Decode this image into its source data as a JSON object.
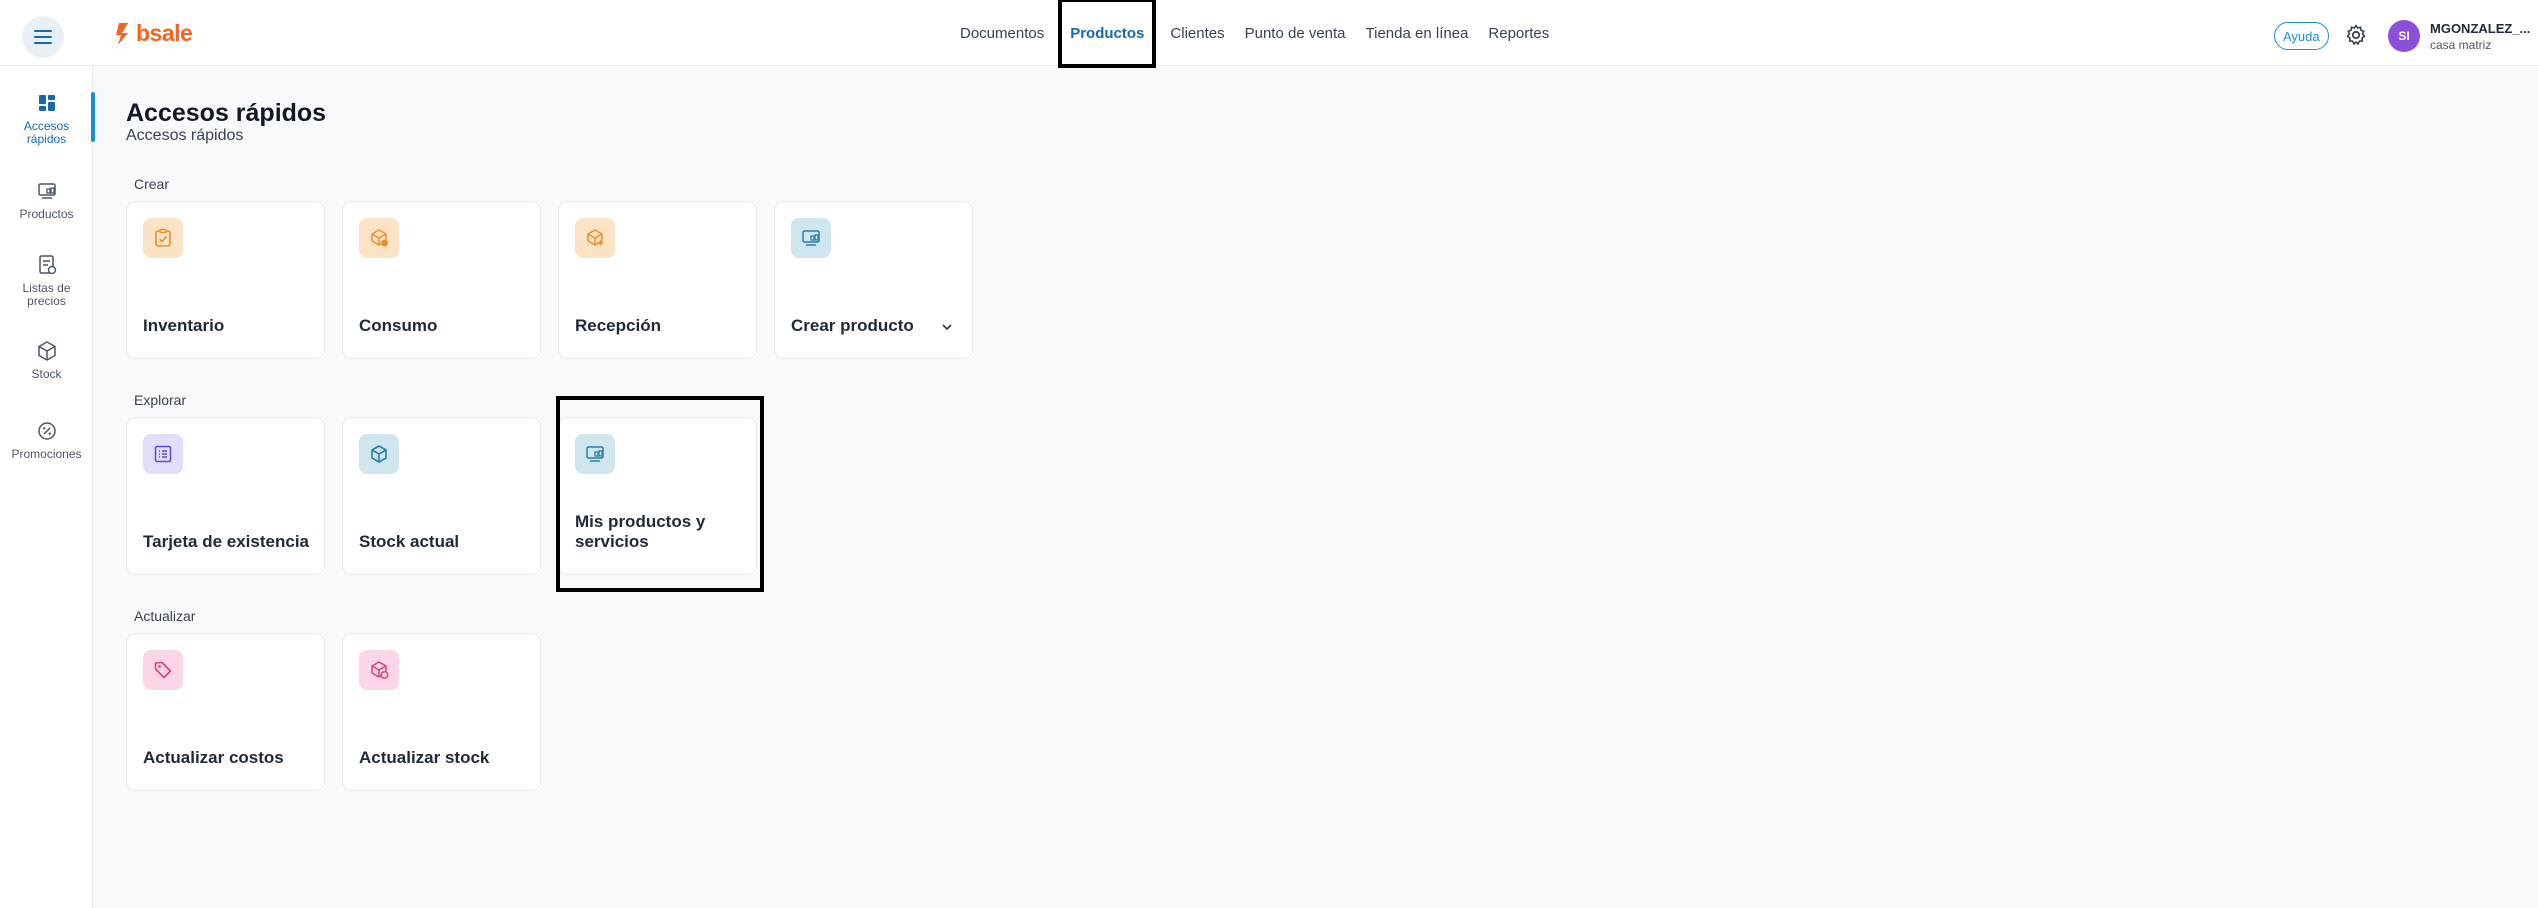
{
  "header": {
    "logo_text": "bsale",
    "nav": [
      {
        "label": "Documentos",
        "active": false
      },
      {
        "label": "Productos",
        "active": true
      },
      {
        "label": "Clientes",
        "active": false
      },
      {
        "label": "Punto de venta",
        "active": false
      },
      {
        "label": "Tienda en línea",
        "active": false
      },
      {
        "label": "Reportes",
        "active": false
      }
    ],
    "help_label": "Ayuda",
    "avatar_initials": "SI",
    "user_name": "MGONZALEZ_...",
    "user_sub": "casa matriz"
  },
  "sidebar": {
    "items": [
      {
        "label": "Accesos rápidos",
        "icon": "dashboard-icon",
        "active": true
      },
      {
        "label": "Productos",
        "icon": "products-icon",
        "active": false
      },
      {
        "label": "Listas de precios",
        "icon": "price-list-icon",
        "active": false
      },
      {
        "label": "Stock",
        "icon": "box-icon",
        "active": false
      },
      {
        "label": "Promociones",
        "icon": "promotion-icon",
        "active": false
      }
    ]
  },
  "main": {
    "title": "Accesos rápidos",
    "subtitle": "Accesos rápidos",
    "sections": [
      {
        "label": "Crear",
        "cards": [
          {
            "label": "Inventario",
            "icon": "clipboard-check-icon",
            "color": "orange"
          },
          {
            "label": "Consumo",
            "icon": "box-alert-icon",
            "color": "orange"
          },
          {
            "label": "Recepción",
            "icon": "box-add-icon",
            "color": "orange"
          },
          {
            "label": "Crear producto",
            "icon": "products-icon",
            "color": "teal",
            "has_dropdown": true
          }
        ]
      },
      {
        "label": "Explorar",
        "cards": [
          {
            "label": "Tarjeta de existencia",
            "icon": "list-card-icon",
            "color": "violet"
          },
          {
            "label": "Stock actual",
            "icon": "box-icon",
            "color": "teal"
          },
          {
            "label": "Mis productos y servicios",
            "icon": "products-icon",
            "color": "teal"
          }
        ]
      },
      {
        "label": "Actualizar",
        "cards": [
          {
            "label": "Actualizar costos",
            "icon": "tag-icon",
            "color": "pink"
          },
          {
            "label": "Actualizar stock",
            "icon": "box-refresh-icon",
            "color": "pink"
          }
        ]
      }
    ]
  },
  "colors": {
    "accent": "#1c8fd4",
    "brand": "#f26522",
    "orange_icon": "#e8902a",
    "teal_icon": "#2b7fa6",
    "violet_icon": "#5b4bd6",
    "pink_icon": "#d9407a"
  }
}
